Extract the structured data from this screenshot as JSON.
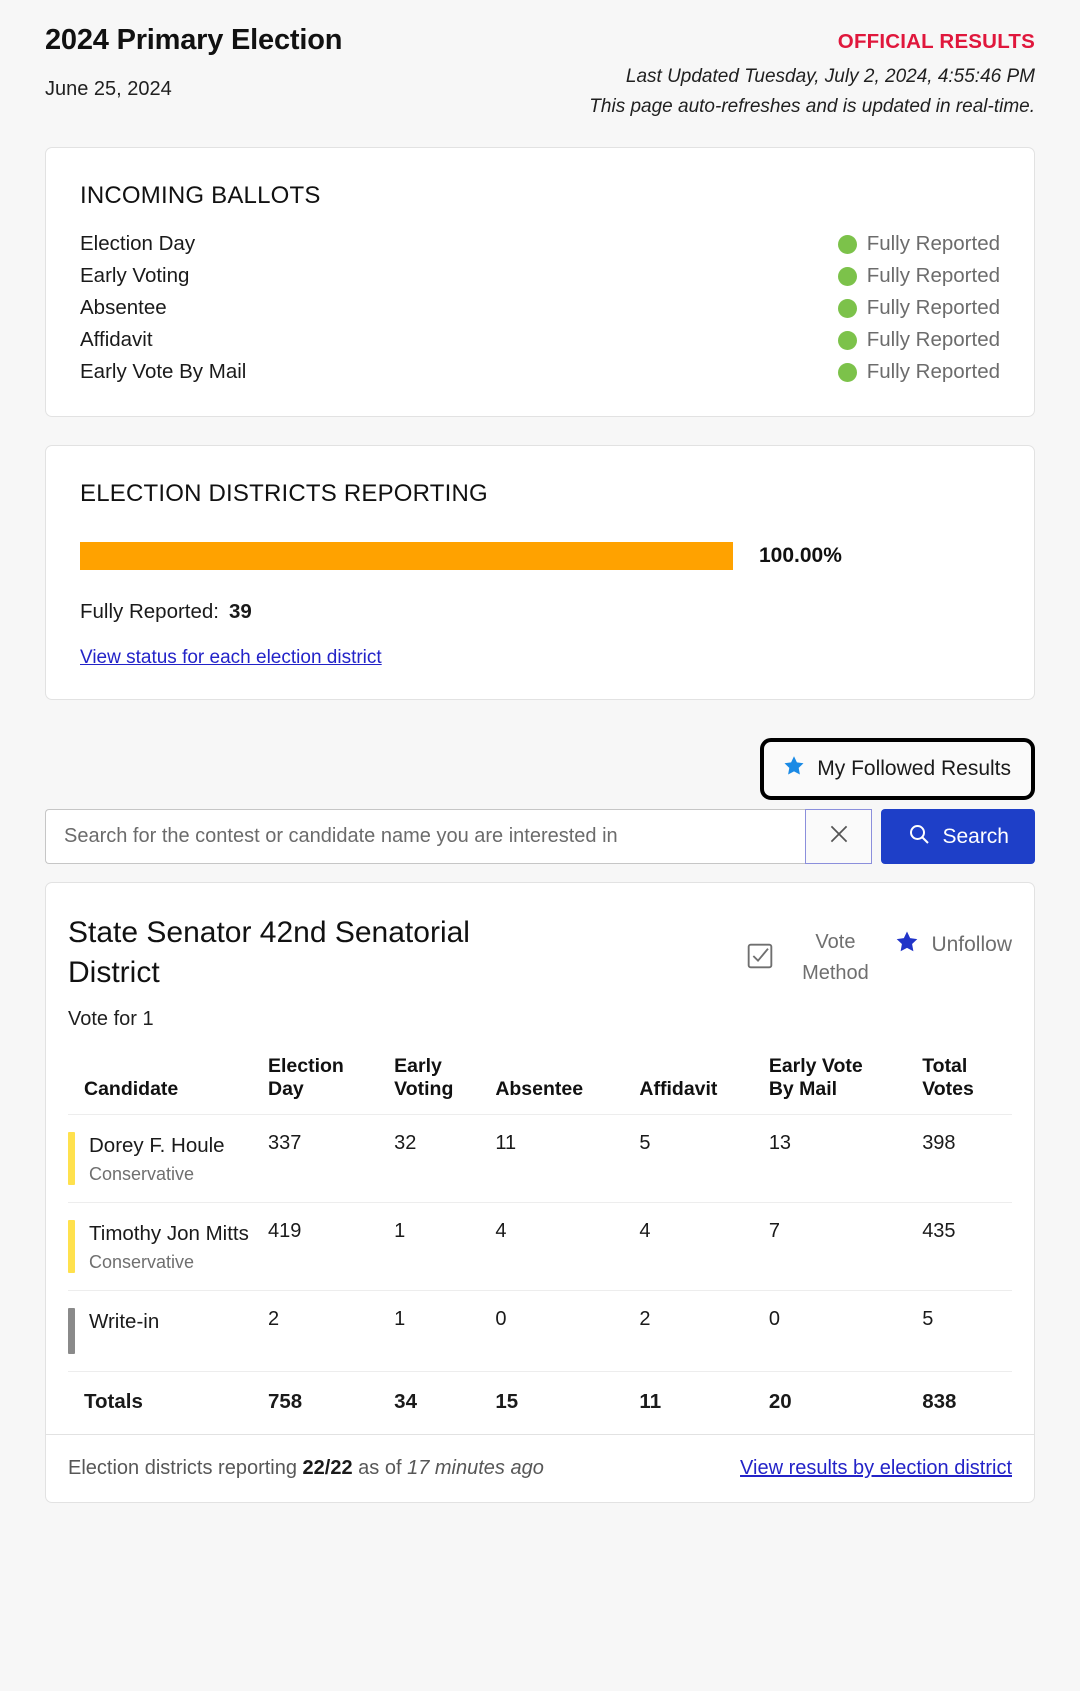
{
  "header": {
    "election_title": "2024 Primary Election",
    "election_date": "June 25, 2024",
    "official_results": "OFFICIAL RESULTS",
    "last_updated": "Last Updated Tuesday, July 2, 2024, 4:55:46 PM",
    "auto_refresh_note": "This page auto-refreshes and is updated in real-time."
  },
  "incoming_ballots": {
    "title": "INCOMING BALLOTS",
    "status_dot_color": "#7cc24a",
    "rows": [
      {
        "name": "Election Day",
        "status": "Fully Reported"
      },
      {
        "name": "Early Voting",
        "status": "Fully Reported"
      },
      {
        "name": "Absentee",
        "status": "Fully Reported"
      },
      {
        "name": "Affidavit",
        "status": "Fully Reported"
      },
      {
        "name": "Early Vote By Mail",
        "status": "Fully Reported"
      }
    ]
  },
  "districts_reporting": {
    "title": "ELECTION DISTRICTS REPORTING",
    "percent_label": "100.00%",
    "percent_value": 100,
    "bar_color": "#ffa200",
    "fully_reported_label": "Fully Reported:",
    "fully_reported_count": "39",
    "link_text": "View status for each election district"
  },
  "toolbar": {
    "followed_results_label": "My Followed Results",
    "followed_star_color": "#1a8ae5",
    "search_placeholder": "Search for the contest or candidate name you are interested in",
    "search_value": "",
    "clear_label": "×",
    "search_button_label": "Search",
    "search_button_color": "#1e3fc8"
  },
  "contest": {
    "title": "State Senator 42nd Senatorial District",
    "vote_method_label_line1": "Vote",
    "vote_method_label_line2": "Method",
    "unfollow_label": "Unfollow",
    "unfollow_star_color": "#2033c8",
    "vote_for": "Vote for 1",
    "columns": [
      "Candidate",
      "Election Day",
      "Early Voting",
      "Absentee",
      "Affidavit",
      "Early Vote By Mail",
      "Total Votes"
    ],
    "candidates": [
      {
        "name": "Dorey F. Houle",
        "party": "Conservative",
        "party_color": "#ffe14d",
        "election_day": "337",
        "early_voting": "32",
        "absentee": "11",
        "affidavit": "5",
        "early_vote_by_mail": "13",
        "total_votes": "398"
      },
      {
        "name": "Timothy Jon Mitts",
        "party": "Conservative",
        "party_color": "#ffe14d",
        "election_day": "419",
        "early_voting": "1",
        "absentee": "4",
        "affidavit": "4",
        "early_vote_by_mail": "7",
        "total_votes": "435"
      },
      {
        "name": "Write-in",
        "party": "",
        "party_color": "#8a8a8a",
        "election_day": "2",
        "early_voting": "1",
        "absentee": "0",
        "affidavit": "2",
        "early_vote_by_mail": "0",
        "total_votes": "5"
      }
    ],
    "totals": {
      "label": "Totals",
      "election_day": "758",
      "early_voting": "34",
      "absentee": "15",
      "affidavit": "11",
      "early_vote_by_mail": "20",
      "total_votes": "838"
    },
    "footer": {
      "reporting_prefix": "Election districts reporting",
      "reporting_count": "22/22",
      "reporting_mid": "as of",
      "reporting_time": "17 minutes ago",
      "results_link": "View results by election district"
    }
  }
}
